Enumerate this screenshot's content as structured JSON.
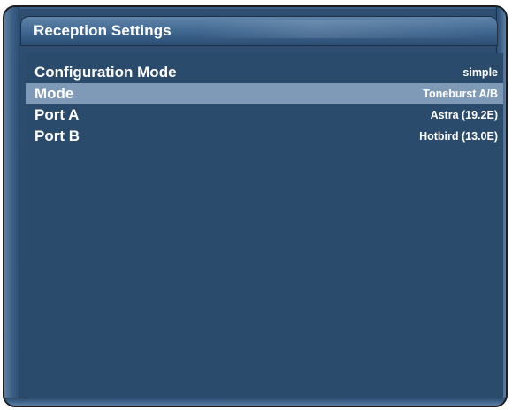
{
  "window": {
    "title": "Reception Settings"
  },
  "settings": [
    {
      "label": "Configuration Mode",
      "value": "simple",
      "selected": false
    },
    {
      "label": "Mode",
      "value": "Toneburst A/B",
      "selected": true
    },
    {
      "label": "Port A",
      "value": "Astra (19.2E)",
      "selected": false
    },
    {
      "label": "Port B",
      "value": "Hotbird (13.0E)",
      "selected": false
    }
  ],
  "colors": {
    "panel": "#2b4b6c",
    "selection": "#7f9ab6",
    "text": "#ffffff"
  }
}
